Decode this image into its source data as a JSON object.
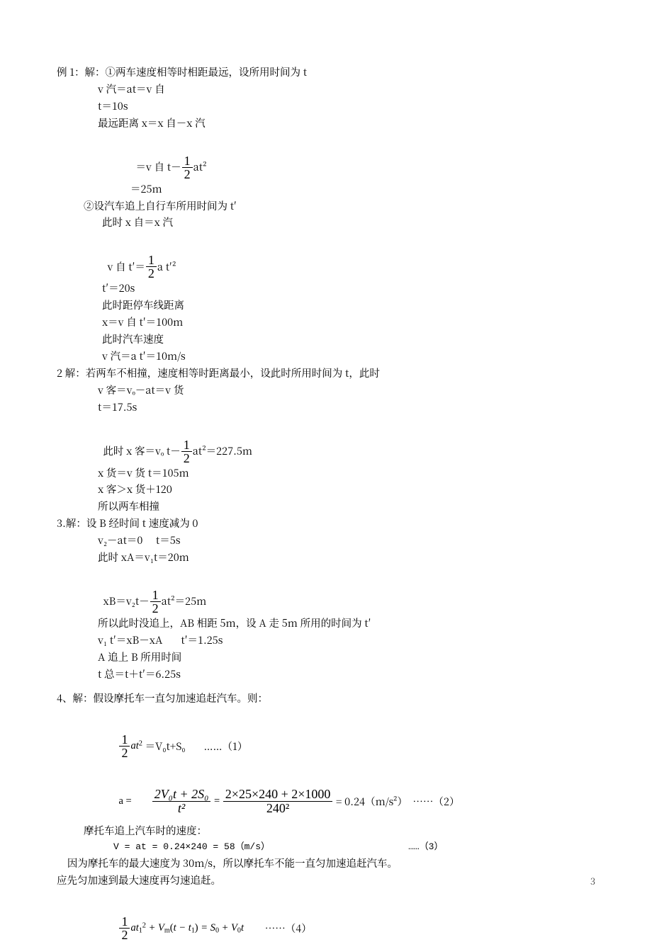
{
  "page_number": "3",
  "ex1": {
    "header": "例 1：解：①两车速度相等时相距最远，设所用时间为 t",
    "l1": "v 汽＝at＝v 自",
    "l2": "t＝10s",
    "l3": "最远距离 x＝x 自－x 汽",
    "l4a": "＝v 自 t－",
    "l4b": "at²",
    "l5": "＝25m",
    "l6": "②设汽车追上自行车所用时间为 t′",
    "l7": "此时 x 自＝x 汽",
    "l8a": "v 自 t′＝",
    "l8b": "a t′²",
    "l9": "t′＝20s",
    "l10": "此时距停车线距离",
    "l11": "x＝v 自 t′＝100m",
    "l12": "此时汽车速度",
    "l13": "v 汽＝a t′＝10m/s"
  },
  "ex2": {
    "header": "2 解：若两车不相撞，速度相等时距离最小，设此时所用时间为 t，此时",
    "l1": "v 客＝vₒ－at＝v 货",
    "l2": "t＝17.5s",
    "l3a": "此时 x 客＝vₒ t－",
    "l3b": "at²＝227.5m",
    "l4": "x 货＝v 货 t＝105m",
    "l5": "x 客＞x 货＋120",
    "l6": "所以两车相撞"
  },
  "ex3": {
    "header": "3.解：设 B 经时间 t 速度减为 0",
    "l1": "v₂－at＝0     t＝5s",
    "l2": "此时 xA＝v₁t＝20m",
    "l3a": "xB＝v₂t－",
    "l3b": "at²＝25m",
    "l4": "所以此时没追上，AB 相距 5m，设 A 走 5m 所用的时间为 t′",
    "l5": "v₁ t′＝xB－xA       t′＝1.25s",
    "l6": "A 追上 B 所用时间",
    "l7": "t 总＝t＋t′＝6.25s"
  },
  "ex4": {
    "header": "4、解：假设摩托车一直匀加速追赶汽车。则：",
    "eq1b": "＝V₀t+S₀       ……（1）",
    "eq2_lhs": "a =",
    "eq2_num1": "2V₀t + 2S₀",
    "eq2_den1": "t²",
    "eq2_num2": "2×25×240 + 2×1000",
    "eq2_den2": "240²",
    "eq2_rhs": "= 0.24（m/s²）  ……（2）",
    "l3": "摩托车追上汽车时的速度：",
    "l4": "V = at = 0.24×240 = 58（m/s）                         ……（3）",
    "l5": "    因为摩托车的最大速度为 30m/s，所以摩托车不能一直匀加速追赶汽车。",
    "l6": "应先匀加速到最大速度再匀速追赶。",
    "eq4_rhs": "        ……（4）"
  },
  "half": {
    "num": "1",
    "den": "2"
  }
}
